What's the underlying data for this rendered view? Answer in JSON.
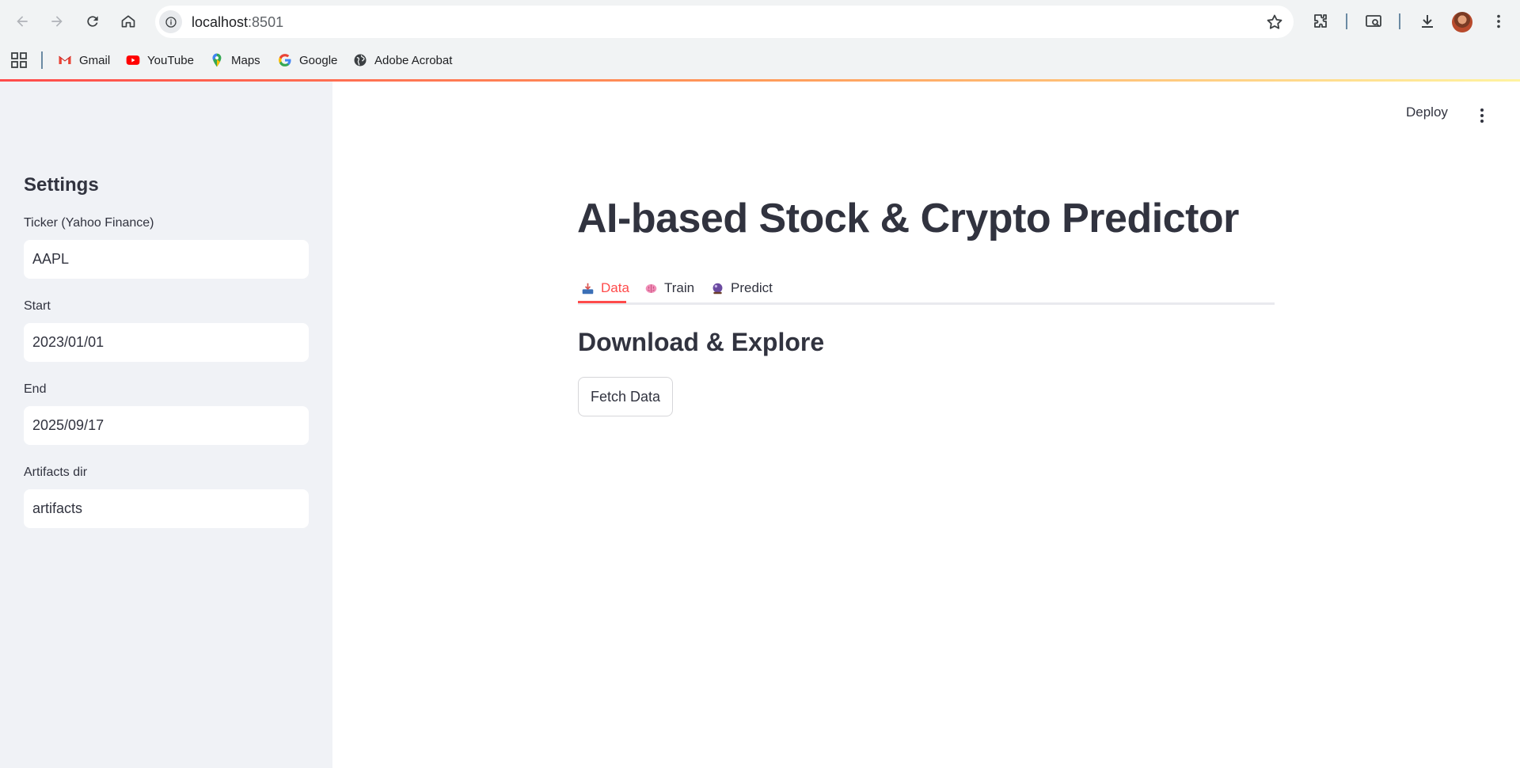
{
  "browser": {
    "url_host": "localhost",
    "url_port": ":8501",
    "bookmarks": [
      {
        "label": "Gmail",
        "icon": "gmail-icon"
      },
      {
        "label": "YouTube",
        "icon": "youtube-icon"
      },
      {
        "label": "Maps",
        "icon": "maps-icon"
      },
      {
        "label": "Google",
        "icon": "google-icon"
      },
      {
        "label": "Adobe Acrobat",
        "icon": "globe-icon"
      }
    ]
  },
  "toolbar": {
    "deploy_label": "Deploy"
  },
  "sidebar": {
    "heading": "Settings",
    "fields": [
      {
        "label": "Ticker (Yahoo Finance)",
        "value": "AAPL"
      },
      {
        "label": "Start",
        "value": "2023/01/01"
      },
      {
        "label": "End",
        "value": "2025/09/17"
      },
      {
        "label": "Artifacts dir",
        "value": "artifacts"
      }
    ]
  },
  "main": {
    "title": "AI-based Stock & Crypto Predictor",
    "tabs": [
      {
        "label": "Data",
        "icon": "inbox-tray-icon",
        "active": true
      },
      {
        "label": "Train",
        "icon": "brain-icon",
        "active": false
      },
      {
        "label": "Predict",
        "icon": "crystal-ball-icon",
        "active": false
      }
    ],
    "section_heading": "Download & Explore",
    "fetch_button_label": "Fetch Data"
  },
  "colors": {
    "accent": "#ff4b4b",
    "sidebar_bg": "#f0f2f6",
    "text": "#31333f",
    "chrome_bg": "#f1f3f4"
  }
}
